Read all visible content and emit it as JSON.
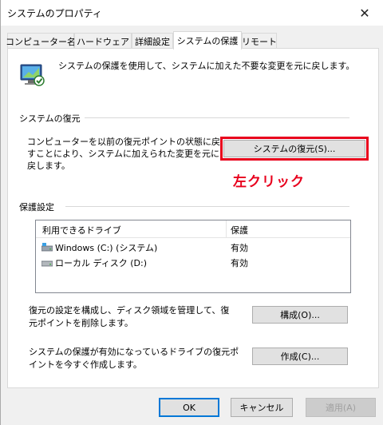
{
  "window": {
    "title": "システムのプロパティ",
    "close_glyph": "✕"
  },
  "tabs": [
    {
      "label": "コンピューター名"
    },
    {
      "label": "ハードウェア"
    },
    {
      "label": "詳細設定"
    },
    {
      "label": "システムの保護",
      "active": true
    },
    {
      "label": "リモート"
    }
  ],
  "intro": {
    "text": "システムの保護を使用して、システムに加えた不要な変更を元に戻します。"
  },
  "restore": {
    "group_label": "システムの復元",
    "description": "コンピューターを以前の復元ポイントの状態に戻すことにより、システムに加えられた変更を元に戻します。",
    "button_label": "システムの復元(S)..."
  },
  "annotation": {
    "text": "左クリック",
    "color": "#e8001c"
  },
  "protection": {
    "group_label": "保護設定",
    "columns": [
      "利用できるドライブ",
      "保護"
    ],
    "drives": [
      {
        "name": "Windows (C:) (システム)",
        "protection": "有効",
        "icon": "system-drive-icon"
      },
      {
        "name": "ローカル ディスク (D:)",
        "protection": "有効",
        "icon": "disk-drive-icon"
      }
    ],
    "configure_text": "復元の設定を構成し、ディスク領域を管理して、復元ポイントを削除します。",
    "configure_button": "構成(O)...",
    "create_text": "システムの保護が有効になっているドライブの復元ポイントを今すぐ作成します。",
    "create_button": "作成(C)..."
  },
  "footer": {
    "ok": "OK",
    "cancel": "キャンセル",
    "apply": "適用(A)"
  }
}
